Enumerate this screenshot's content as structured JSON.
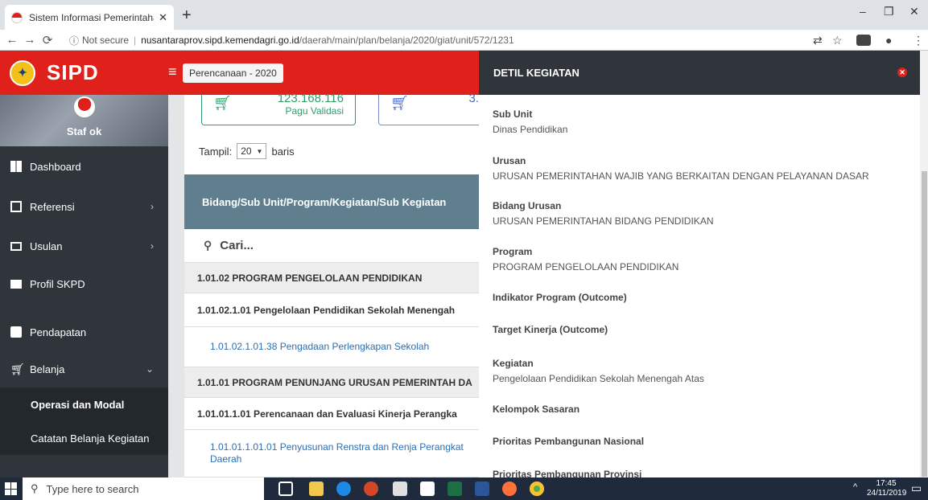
{
  "browser": {
    "tab_title": "Sistem Informasi Pemerintahan D",
    "tab_close": "✕",
    "new_tab": "+",
    "minimize": "–",
    "restore": "❐",
    "close": "✕",
    "security_label": "Not secure",
    "url_host": "nusantaraprov.sipd.kemendagri.go.id",
    "url_path": "/daerah/main/plan/belanja/2020/giat/unit/572/1231"
  },
  "sidebar": {
    "brand": "SIPD",
    "user_name": "Staf ok",
    "menu": [
      {
        "label": "Dashboard"
      },
      {
        "label": "Referensi"
      },
      {
        "label": "Usulan"
      },
      {
        "label": "Profil SKPD"
      },
      {
        "label": "Pendapatan"
      },
      {
        "label": "Belanja"
      }
    ],
    "belanja_sub": [
      {
        "label": "Operasi dan Modal"
      },
      {
        "label": "Catatan Belanja Kegiatan"
      }
    ]
  },
  "main": {
    "breadcrumb_button": "Perencanaan - 2020",
    "card1_value": "123.168.116",
    "card1_label": "Pagu Validasi",
    "card2_value": "3.",
    "tampil_label": "Tampil:",
    "tampil_value": "20",
    "baris_label": "baris",
    "table_header": "Bidang/Sub Unit/Program/Kegiatan/Sub Kegiatan",
    "search_placeholder": "Cari...",
    "rows": [
      {
        "text": "1.01.02 PROGRAM PENGELOLAAN PENDIDIKAN"
      },
      {
        "text": "1.01.02.1.01 Pengelolaan Pendidikan Sekolah Menengah"
      },
      {
        "text": "1.01.02.1.01.38 Pengadaan Perlengkapan Sekolah"
      },
      {
        "text": "1.01.01 PROGRAM PENUNJANG URUSAN PEMERINTAH DA"
      },
      {
        "text": "1.01.01.1.01 Perencanaan dan Evaluasi Kinerja Perangka"
      },
      {
        "text": "1.01.01.1.01.01 Penyusunan Renstra dan Renja Perangkat Daerah"
      }
    ]
  },
  "drawer": {
    "title": "DETIL KEGIATAN",
    "close": "✕",
    "fields": [
      {
        "label": "Sub Unit",
        "value": "Dinas Pendidikan"
      },
      {
        "label": "Urusan",
        "value": "URUSAN PEMERINTAHAN WAJIB YANG BERKAITAN DENGAN PELAYANAN DASAR"
      },
      {
        "label": "Bidang Urusan",
        "value": "URUSAN PEMERINTAHAN BIDANG PENDIDIKAN"
      },
      {
        "label": "Program",
        "value": "PROGRAM PENGELOLAAN PENDIDIKAN"
      },
      {
        "label": "Indikator Program (Outcome)",
        "value": ""
      },
      {
        "label": "Target Kinerja (Outcome)",
        "value": ""
      },
      {
        "label": "Kegiatan",
        "value": "Pengelolaan Pendidikan Sekolah Menengah Atas"
      },
      {
        "label": "Kelompok Sasaran",
        "value": ""
      },
      {
        "label": "Prioritas Pembangunan Nasional",
        "value": ""
      },
      {
        "label": "Prioritas Pembangunan Provinsi",
        "value": ""
      }
    ]
  },
  "taskbar": {
    "search_placeholder": "Type here to search",
    "time": "17:45",
    "date": "24/11/2019"
  },
  "colors": {
    "brand_red": "#e0211b",
    "sidebar_dark": "#2f353a",
    "table_header": "#5f7f8e",
    "link_blue": "#2b6fb3",
    "card_green": "#2f9e6b"
  }
}
